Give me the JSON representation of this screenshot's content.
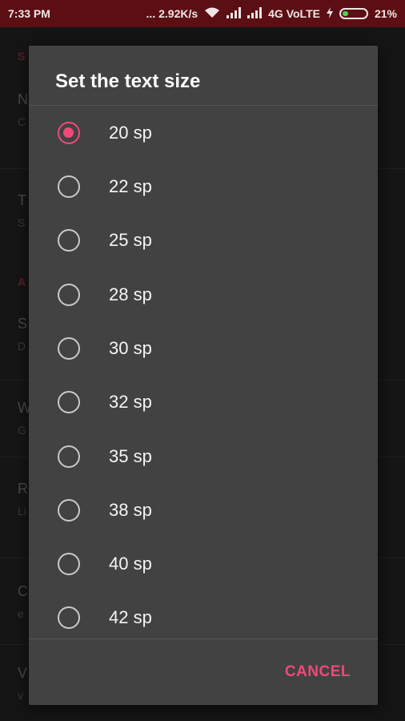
{
  "status_bar": {
    "time": "7:33 PM",
    "network_speed": "... 2.92K/s",
    "network_type": "4G VoLTE",
    "battery": "21%",
    "icons": [
      "wifi-icon",
      "signal-icon",
      "signal-icon",
      "charging-icon",
      "battery-icon"
    ]
  },
  "background": {
    "headers": [
      "S",
      "A"
    ],
    "items": [
      {
        "title": "N",
        "sub": "C"
      },
      {
        "title": "T",
        "sub": "S"
      },
      {
        "title": "S",
        "sub": "D"
      },
      {
        "title": "W",
        "sub": "G"
      },
      {
        "title": "R",
        "sub": "Li"
      },
      {
        "title": "C",
        "sub": "e"
      },
      {
        "title": "V",
        "sub": "v"
      }
    ]
  },
  "dialog": {
    "title": "Set the text size",
    "options": [
      {
        "label": "20 sp",
        "checked": true
      },
      {
        "label": "22 sp",
        "checked": false
      },
      {
        "label": "25 sp",
        "checked": false
      },
      {
        "label": "28 sp",
        "checked": false
      },
      {
        "label": "30 sp",
        "checked": false
      },
      {
        "label": "32 sp",
        "checked": false
      },
      {
        "label": "35 sp",
        "checked": false
      },
      {
        "label": "38 sp",
        "checked": false
      },
      {
        "label": "40 sp",
        "checked": false
      },
      {
        "label": "42 sp",
        "checked": false
      }
    ],
    "cancel_label": "CANCEL"
  },
  "colors": {
    "accent": "#f0487a",
    "status_bar": "#5b0f14",
    "dialog_bg": "#424242"
  }
}
